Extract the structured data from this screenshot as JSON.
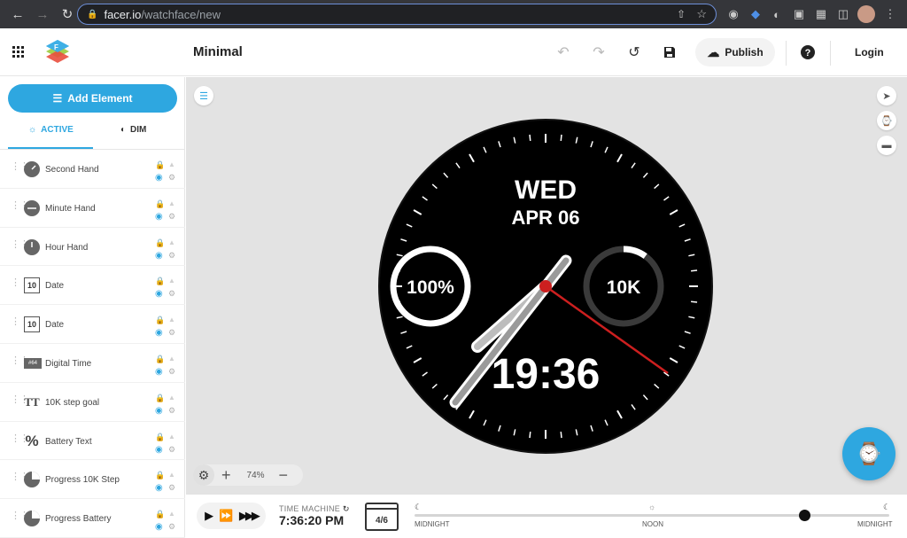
{
  "browser": {
    "url_host": "facer.io",
    "url_path": "/watchface/new"
  },
  "header": {
    "title": "Minimal",
    "publish_label": "Publish",
    "login_label": "Login"
  },
  "sidebar": {
    "add_element_label": "Add Element",
    "tabs": [
      {
        "label": "ACTIVE",
        "selected": true
      },
      {
        "label": "DIM",
        "selected": false
      }
    ],
    "layers": [
      {
        "label": "Second Hand",
        "icon": "clock-icon"
      },
      {
        "label": "Minute Hand",
        "icon": "clock-icon"
      },
      {
        "label": "Hour Hand",
        "icon": "clock-icon"
      },
      {
        "label": "Date",
        "icon": "calendar-icon"
      },
      {
        "label": "Date",
        "icon": "calendar-icon"
      },
      {
        "label": "Digital Time",
        "icon": "digital-time-icon"
      },
      {
        "label": "10K step goal",
        "icon": "text-icon"
      },
      {
        "label": "Battery Text",
        "icon": "percent-icon"
      },
      {
        "label": "Progress 10K Step",
        "icon": "progress-icon"
      },
      {
        "label": "Progress Battery",
        "icon": "progress-icon"
      }
    ],
    "layer_icon_text": {
      "calendar": "10",
      "digital": "#64",
      "text": "TT"
    }
  },
  "watch": {
    "day": "WED",
    "date": "APR 06",
    "battery_text": "100%",
    "battery_progress": 1.0,
    "steps_text": "10K",
    "steps_progress": 0.1,
    "time": "19:36",
    "hand_color": "#ffffff",
    "second_hand_color": "#cc1f1f"
  },
  "canvas": {
    "zoom": "74%"
  },
  "time_machine": {
    "label": "TIME MACHINE",
    "time": "7:36:20 PM",
    "calendar_badge": "4/6",
    "labels": [
      "MIDNIGHT",
      "NOON",
      "MIDNIGHT"
    ],
    "position": 0.82
  },
  "colors": {
    "accent": "#2ea7e0"
  }
}
